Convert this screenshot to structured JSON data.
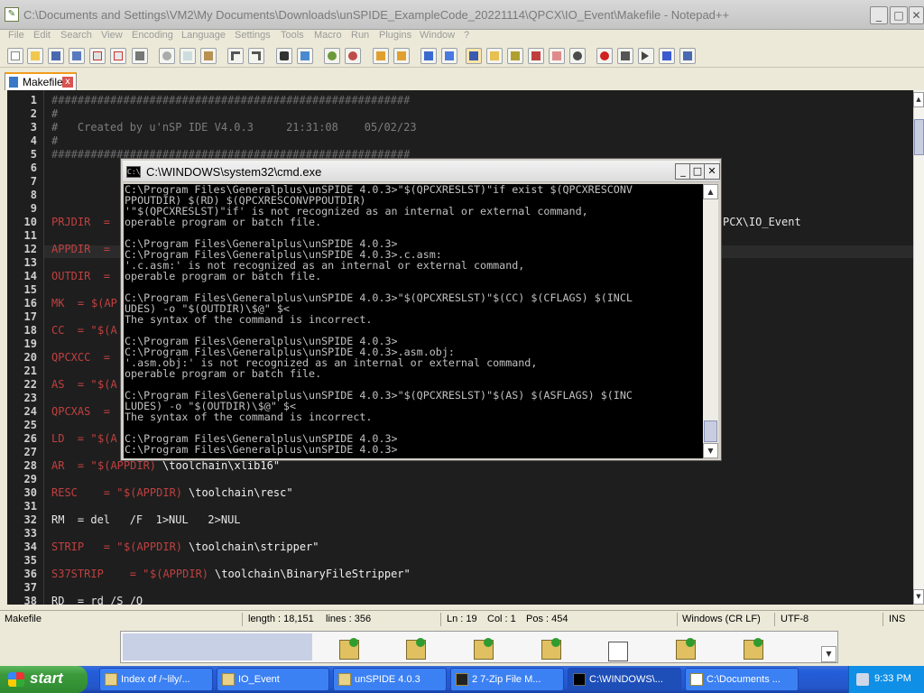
{
  "notepad": {
    "title": "C:\\Documents and Settings\\VM2\\My Documents\\Downloads\\unSPIDE_ExampleCode_20221114\\QPCX\\IO_Event\\Makefile - Notepad++",
    "menu": [
      "File",
      "Edit",
      "Search",
      "View",
      "Encoding",
      "Language",
      "Settings",
      "Tools",
      "Macro",
      "Run",
      "Plugins",
      "Window",
      "?"
    ],
    "window_buttons": {
      "minimize": "_",
      "maximize": "□",
      "close": "✕"
    },
    "tab": {
      "label": "Makefile",
      "close": "x"
    },
    "line_numbers": [
      "1",
      "2",
      "3",
      "4",
      "5",
      "6",
      "7",
      "8",
      "9",
      "10",
      "11",
      "12",
      "13",
      "14",
      "15",
      "16",
      "17",
      "18",
      "19",
      "20",
      "21",
      "22",
      "23",
      "24",
      "25",
      "26",
      "27",
      "28",
      "29",
      "30",
      "31",
      "32",
      "33",
      "34",
      "35",
      "36",
      "37",
      "38"
    ],
    "code": {
      "l1": "#######################################################",
      "l2": "#",
      "l3": "#   Created by u'nSP IDE V4.0.3     21:31:08    05/02/23",
      "l4": "#",
      "l5": "#######################################################",
      "l10_a": "PRJDIR  =",
      "l10_b": "PCX\\IO_Event",
      "l12": "APPDIR  =",
      "l14": "OUTDIR  =",
      "l16_a": "MK  = ",
      "l16_b": "$(AP",
      "l18_a": "CC  = \"",
      "l18_b": "$(A",
      "l20": "QPCXCC  =",
      "l22_a": "AS  = \"",
      "l22_b": "$(A",
      "l24": "QPCXAS  =",
      "l26_a": "LD  = \"",
      "l26_b": "$(A",
      "l28_a": "AR  = \"",
      "l28_b": "$(APPDIR)",
      "l28_c": "\\toolchain\\xlib16\"",
      "l30_a": "RESC    = \"",
      "l30_b": "$(APPDIR)",
      "l30_c": "\\toolchain\\resc\"",
      "l32": "RM  = del   /F  1>NUL   2>NUL",
      "l34_a": "STRIP   = \"",
      "l34_b": "$(APPDIR)",
      "l34_c": "\\toolchain\\stripper\"",
      "l36_a": "S37STRIP    = \"",
      "l36_b": "$(APPDIR)",
      "l36_c": "\\toolchain\\BinaryFileStripper\"",
      "l38": "RD  = rd /S /Q"
    },
    "status": {
      "file_type": "Makefile",
      "length": "length : 18,151",
      "lines": "lines : 356",
      "ln": "Ln : 19",
      "col": "Col : 1",
      "pos": "Pos : 454",
      "eol": "Windows (CR LF)",
      "encoding": "UTF-8",
      "mode": "INS"
    }
  },
  "cmd": {
    "title": "C:\\WINDOWS\\system32\\cmd.exe",
    "icon_text": "C:\\",
    "buttons": {
      "minimize": "_",
      "maximize": "□",
      "close": "✕"
    },
    "output": "C:\\Program Files\\Generalplus\\unSPIDE 4.0.3>\"$(QPCXRESLST)\"if exist $(QPCXRESCONV\nPPOUTDIR) $(RD) $(QPCXRESCONVPPOUTDIR)\n'\"$(QPCXRESLST)\"if' is not recognized as an internal or external command,\noperable program or batch file.\n\nC:\\Program Files\\Generalplus\\unSPIDE 4.0.3>\nC:\\Program Files\\Generalplus\\unSPIDE 4.0.3>.c.asm:\n'.c.asm:' is not recognized as an internal or external command,\noperable program or batch file.\n\nC:\\Program Files\\Generalplus\\unSPIDE 4.0.3>\"$(QPCXRESLST)\"$(CC) $(CFLAGS) $(INCL\nUDES) -o \"$(OUTDIR)\\$@\" $<\nThe syntax of the command is incorrect.\n\nC:\\Program Files\\Generalplus\\unSPIDE 4.0.3>\nC:\\Program Files\\Generalplus\\unSPIDE 4.0.3>.asm.obj:\n'.asm.obj:' is not recognized as an internal or external command,\noperable program or batch file.\n\nC:\\Program Files\\Generalplus\\unSPIDE 4.0.3>\"$(QPCXRESLST)\"$(AS) $(ASFLAGS) $(INC\nLUDES) -o \"$(OUTDIR)\\$@\" $<\nThe syntax of the command is incorrect.\n\nC:\\Program Files\\Generalplus\\unSPIDE 4.0.3>\nC:\\Program Files\\Generalplus\\unSPIDE 4.0.3>",
    "scroll_up": "▲",
    "scroll_down": "▼"
  },
  "taskbar": {
    "start_label": "start",
    "buttons": [
      {
        "label": "Index of /~lily/..."
      },
      {
        "label": "IO_Event"
      },
      {
        "label": "unSPIDE 4.0.3"
      },
      {
        "label": "2  7-Zip File M..."
      },
      {
        "label": "C:\\WINDOWS\\..."
      },
      {
        "label": "C:\\Documents ..."
      }
    ],
    "clock": "9:33 PM"
  },
  "icons": [
    "notepad-icon",
    "new-file-icon",
    "open-icon",
    "save-icon",
    "close-icon",
    "print-icon",
    "cut-icon",
    "copy-icon",
    "paste-icon",
    "undo-icon",
    "redo-icon",
    "find-icon",
    "zoom-icon",
    "macro-record-icon",
    "macro-play-icon",
    "package-icon"
  ]
}
